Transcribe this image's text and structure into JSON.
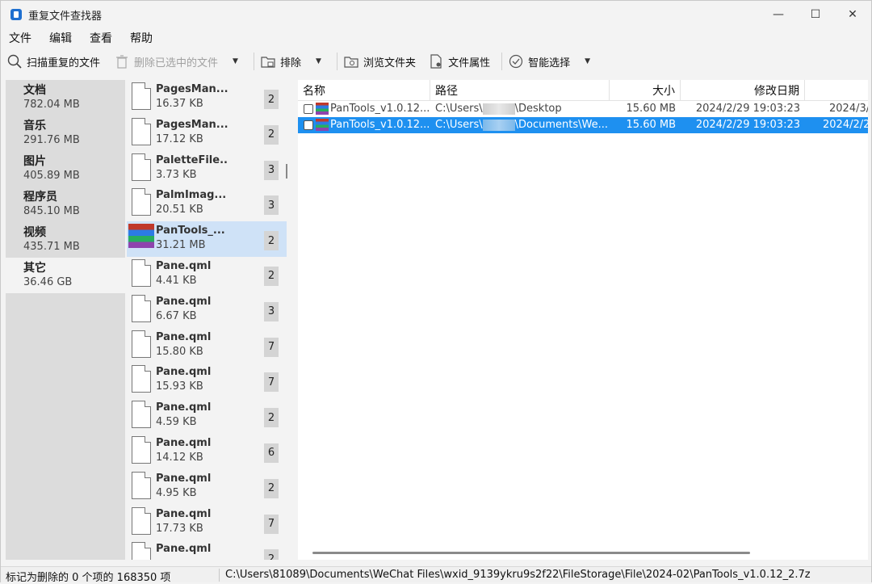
{
  "window": {
    "title": "重复文件查找器",
    "minimize": "—",
    "maximize": "☐",
    "close": "✕"
  },
  "menu": [
    "文件",
    "编辑",
    "查看",
    "帮助"
  ],
  "toolbar": {
    "scan": "扫描重复的文件",
    "delete_selected": "删除已选中的文件",
    "exclude": "排除",
    "browse_folder": "浏览文件夹",
    "file_props": "文件属性",
    "smart_select": "智能选择"
  },
  "categories": [
    {
      "name": "文档",
      "size": "782.04 MB"
    },
    {
      "name": "音乐",
      "size": "291.76 MB"
    },
    {
      "name": "图片",
      "size": "405.89 MB"
    },
    {
      "name": "程序员",
      "size": "845.10 MB"
    },
    {
      "name": "视频",
      "size": "435.71 MB"
    },
    {
      "name": "其它",
      "size": "36.46 GB"
    }
  ],
  "files": [
    {
      "name": "PagesMan...",
      "size": "16.37 KB",
      "count": "2"
    },
    {
      "name": "PagesMan...",
      "size": "17.12 KB",
      "count": "2"
    },
    {
      "name": "PaletteFile...",
      "size": "3.73 KB",
      "count": "3"
    },
    {
      "name": "PalmImag...",
      "size": "20.51 KB",
      "count": "3"
    },
    {
      "name": "PanTools_...",
      "size": "31.21 MB",
      "count": "2"
    },
    {
      "name": "Pane.qml",
      "size": "4.41 KB",
      "count": "2"
    },
    {
      "name": "Pane.qml",
      "size": "6.67 KB",
      "count": "3"
    },
    {
      "name": "Pane.qml",
      "size": "15.80 KB",
      "count": "7"
    },
    {
      "name": "Pane.qml",
      "size": "15.93 KB",
      "count": "7"
    },
    {
      "name": "Pane.qml",
      "size": "4.59 KB",
      "count": "2"
    },
    {
      "name": "Pane.qml",
      "size": "14.12 KB",
      "count": "6"
    },
    {
      "name": "Pane.qml",
      "size": "4.95 KB",
      "count": "2"
    },
    {
      "name": "Pane.qml",
      "size": "17.73 KB",
      "count": "7"
    },
    {
      "name": "Pane.qml",
      "size": "",
      "count": "2"
    }
  ],
  "detail": {
    "headers": {
      "name": "名称",
      "path": "路径",
      "size": "大小",
      "modified": "修改日期"
    },
    "rows": [
      {
        "name": "PanTools_v1.0.12...",
        "path_prefix": "C:\\Users\\",
        "path_suffix": "\\Desktop",
        "size": "15.60 MB",
        "modified": "2024/2/29 19:03:23",
        "extra": "2024/3/"
      },
      {
        "name": "PanTools_v1.0.12...",
        "path_prefix": "C:\\Users\\",
        "path_suffix": "\\Documents\\We...",
        "size": "15.60 MB",
        "modified": "2024/2/29 19:03:23",
        "extra": "2024/2/2"
      }
    ]
  },
  "status": {
    "left": "标记为删除的 0 个项的 168350 项",
    "path": "C:\\Users\\81089\\Documents\\WeChat Files\\wxid_9139ykru9s2f22\\FileStorage\\File\\2024-02\\PanTools_v1.0.12_2.7z"
  }
}
